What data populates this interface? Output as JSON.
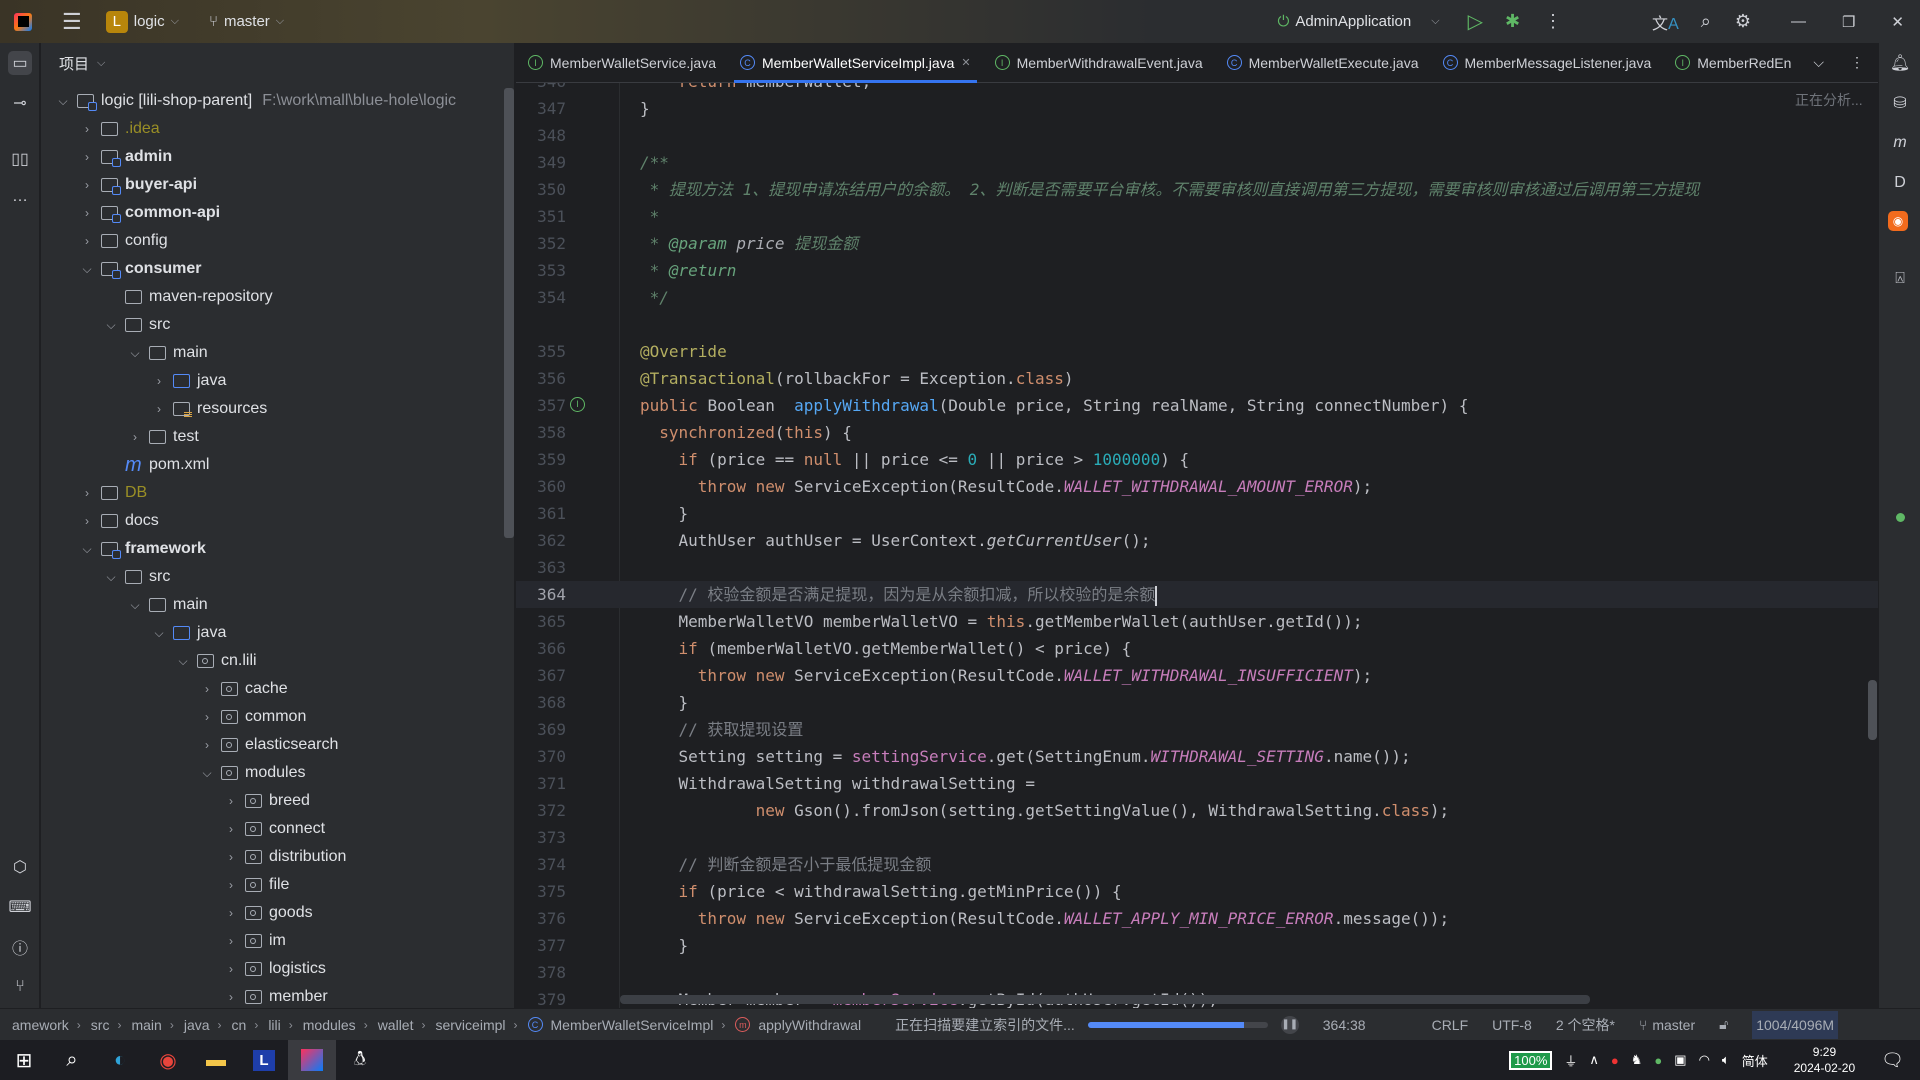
{
  "titlebar": {
    "project_initial": "L",
    "project": "logic",
    "branch": "master",
    "run_config": "AdminApplication"
  },
  "project_panel": {
    "title": "项目"
  },
  "tree": [
    {
      "d": 0,
      "name": "logic [lili-shop-parent]",
      "path": "F:\\work\\mall\\blue-hole\\logic",
      "icon": "mod",
      "exp": "open"
    },
    {
      "d": 1,
      "name": ".idea",
      "icon": "folder",
      "exp": "closed",
      "style": "excluded"
    },
    {
      "d": 1,
      "name": "admin",
      "icon": "mod",
      "exp": "closed",
      "style": "bold"
    },
    {
      "d": 1,
      "name": "buyer-api",
      "icon": "mod",
      "exp": "closed",
      "style": "bold"
    },
    {
      "d": 1,
      "name": "common-api",
      "icon": "mod",
      "exp": "closed",
      "style": "bold"
    },
    {
      "d": 1,
      "name": "config",
      "icon": "folder",
      "exp": "closed"
    },
    {
      "d": 1,
      "name": "consumer",
      "icon": "mod",
      "exp": "open",
      "style": "bold"
    },
    {
      "d": 2,
      "name": "maven-repository",
      "icon": "folder",
      "exp": "none"
    },
    {
      "d": 2,
      "name": "src",
      "icon": "folder",
      "exp": "open"
    },
    {
      "d": 3,
      "name": "main",
      "icon": "folder",
      "exp": "open"
    },
    {
      "d": 4,
      "name": "java",
      "icon": "src",
      "exp": "closed"
    },
    {
      "d": 4,
      "name": "resources",
      "icon": "res",
      "exp": "closed"
    },
    {
      "d": 3,
      "name": "test",
      "icon": "folder",
      "exp": "closed"
    },
    {
      "d": 2,
      "name": "pom.xml",
      "icon": "mvn",
      "exp": "none"
    },
    {
      "d": 1,
      "name": "DB",
      "icon": "folder",
      "exp": "closed",
      "style": "excluded"
    },
    {
      "d": 1,
      "name": "docs",
      "icon": "folder",
      "exp": "closed"
    },
    {
      "d": 1,
      "name": "framework",
      "icon": "mod",
      "exp": "open",
      "style": "bold"
    },
    {
      "d": 2,
      "name": "src",
      "icon": "folder",
      "exp": "open"
    },
    {
      "d": 3,
      "name": "main",
      "icon": "folder",
      "exp": "open"
    },
    {
      "d": 4,
      "name": "java",
      "icon": "src",
      "exp": "open"
    },
    {
      "d": 5,
      "name": "cn.lili",
      "icon": "pkg",
      "exp": "open"
    },
    {
      "d": 6,
      "name": "cache",
      "icon": "pkg",
      "exp": "closed"
    },
    {
      "d": 6,
      "name": "common",
      "icon": "pkg",
      "exp": "closed"
    },
    {
      "d": 6,
      "name": "elasticsearch",
      "icon": "pkg",
      "exp": "closed"
    },
    {
      "d": 6,
      "name": "modules",
      "icon": "pkg",
      "exp": "open"
    },
    {
      "d": 7,
      "name": "breed",
      "icon": "pkg",
      "exp": "closed"
    },
    {
      "d": 7,
      "name": "connect",
      "icon": "pkg",
      "exp": "closed"
    },
    {
      "d": 7,
      "name": "distribution",
      "icon": "pkg",
      "exp": "closed"
    },
    {
      "d": 7,
      "name": "file",
      "icon": "pkg",
      "exp": "closed"
    },
    {
      "d": 7,
      "name": "goods",
      "icon": "pkg",
      "exp": "closed"
    },
    {
      "d": 7,
      "name": "im",
      "icon": "pkg",
      "exp": "closed"
    },
    {
      "d": 7,
      "name": "logistics",
      "icon": "pkg",
      "exp": "closed"
    },
    {
      "d": 7,
      "name": "member",
      "icon": "pkg",
      "exp": "closed"
    }
  ],
  "tabs": [
    {
      "label": "MemberWalletService.java",
      "kind": "I"
    },
    {
      "label": "MemberWalletServiceImpl.java",
      "kind": "C",
      "active": true
    },
    {
      "label": "MemberWithdrawalEvent.java",
      "kind": "I"
    },
    {
      "label": "MemberWalletExecute.java",
      "kind": "C"
    },
    {
      "label": "MemberMessageListener.java",
      "kind": "C"
    },
    {
      "label": "MemberRedEn",
      "kind": "I"
    }
  ],
  "editor": {
    "analyzing": "正在分析...",
    "current_line": 364,
    "lines": [
      {
        "n": 346,
        "t": [
          [
            "",
            "    "
          ],
          [
            "kw",
            "return "
          ],
          [
            "",
            "memberWallet;"
          ]
        ]
      },
      {
        "n": 347,
        "t": [
          [
            "",
            "}"
          ]
        ]
      },
      {
        "n": 348,
        "t": []
      },
      {
        "n": 349,
        "t": [
          [
            "doc",
            "/**"
          ]
        ]
      },
      {
        "n": 350,
        "t": [
          [
            "doc",
            " * 提现方法 1、提现申请冻结用户的余额。 2、判断是否需要平台审核。不需要审核则直接调用第三方提现，需要审核则审核通过后调用第三方提现"
          ]
        ]
      },
      {
        "n": 351,
        "t": [
          [
            "doc",
            " *"
          ]
        ]
      },
      {
        "n": 352,
        "t": [
          [
            "doc",
            " * "
          ],
          [
            "doctag",
            "@param "
          ],
          [
            "docp",
            "price "
          ],
          [
            "doc",
            "提现金额"
          ]
        ]
      },
      {
        "n": 353,
        "t": [
          [
            "doc",
            " * "
          ],
          [
            "doctag",
            "@return"
          ]
        ]
      },
      {
        "n": 354,
        "t": [
          [
            "doc",
            " */"
          ]
        ]
      },
      {
        "n": 355,
        "gap": true,
        "t": [
          [
            "ann",
            "@Override"
          ]
        ]
      },
      {
        "n": 356,
        "t": [
          [
            "ann",
            "@Transactional"
          ],
          [
            "",
            "(rollbackFor = Exception."
          ],
          [
            "kw",
            "class"
          ],
          [
            "",
            ")"
          ]
        ]
      },
      {
        "n": 357,
        "impl": true,
        "t": [
          [
            "kw",
            "public "
          ],
          [
            "",
            "Boolean  "
          ],
          [
            "fn",
            "applyWithdrawal"
          ],
          [
            "",
            "(Double price, String realName, String connectNumber) {"
          ]
        ]
      },
      {
        "n": 358,
        "t": [
          [
            "",
            "  "
          ],
          [
            "kw",
            "synchronized"
          ],
          [
            "",
            "("
          ],
          [
            "kw",
            "this"
          ],
          [
            "",
            ") {"
          ]
        ]
      },
      {
        "n": 359,
        "t": [
          [
            "",
            "    "
          ],
          [
            "kw",
            "if "
          ],
          [
            "",
            "(price == "
          ],
          [
            "kw",
            "null"
          ],
          [
            "",
            " || price <= "
          ],
          [
            "num",
            "0"
          ],
          [
            "",
            " || price > "
          ],
          [
            "num",
            "1000000"
          ],
          [
            "",
            ") {"
          ]
        ]
      },
      {
        "n": 360,
        "t": [
          [
            "",
            "      "
          ],
          [
            "kw",
            "throw new "
          ],
          [
            "",
            "ServiceException(ResultCode."
          ],
          [
            "const",
            "WALLET_WITHDRAWAL_AMOUNT_ERROR"
          ],
          [
            "",
            ");"
          ]
        ]
      },
      {
        "n": 361,
        "t": [
          [
            "",
            "    }"
          ]
        ]
      },
      {
        "n": 362,
        "t": [
          [
            "",
            "    AuthUser authUser = UserContext."
          ],
          [
            "st",
            "getCurrentUser"
          ],
          [
            "",
            "();"
          ]
        ]
      },
      {
        "n": 363,
        "t": []
      },
      {
        "n": 364,
        "caret": true,
        "t": [
          [
            "",
            "    "
          ],
          [
            "cm",
            "// 校验金额是否满足提现，因为是从余额扣减，所以校验的是余额"
          ]
        ]
      },
      {
        "n": 365,
        "t": [
          [
            "",
            "    MemberWalletVO memberWalletVO = "
          ],
          [
            "kw",
            "this"
          ],
          [
            "",
            ".getMemberWallet(authUser.getId());"
          ]
        ]
      },
      {
        "n": 366,
        "t": [
          [
            "",
            "    "
          ],
          [
            "kw",
            "if "
          ],
          [
            "",
            "(memberWalletVO.getMemberWallet() < price) {"
          ]
        ]
      },
      {
        "n": 367,
        "t": [
          [
            "",
            "      "
          ],
          [
            "kw",
            "throw new "
          ],
          [
            "",
            "ServiceException(ResultCode."
          ],
          [
            "const",
            "WALLET_WITHDRAWAL_INSUFFICIENT"
          ],
          [
            "",
            ");"
          ]
        ]
      },
      {
        "n": 368,
        "t": [
          [
            "",
            "    }"
          ]
        ]
      },
      {
        "n": 369,
        "t": [
          [
            "",
            "    "
          ],
          [
            "cm",
            "// 获取提现设置"
          ]
        ]
      },
      {
        "n": 370,
        "t": [
          [
            "",
            "    Setting setting = "
          ],
          [
            "field",
            "settingService"
          ],
          [
            "",
            ".get(SettingEnum."
          ],
          [
            "const",
            "WITHDRAWAL_SETTING"
          ],
          [
            "",
            ".name());"
          ]
        ]
      },
      {
        "n": 371,
        "t": [
          [
            "",
            "    WithdrawalSetting withdrawalSetting ="
          ]
        ]
      },
      {
        "n": 372,
        "t": [
          [
            "",
            "            "
          ],
          [
            "kw",
            "new "
          ],
          [
            "",
            "Gson().fromJson(setting.getSettingValue(), WithdrawalSetting."
          ],
          [
            "kw",
            "class"
          ],
          [
            "",
            ");"
          ]
        ]
      },
      {
        "n": 373,
        "t": []
      },
      {
        "n": 374,
        "t": [
          [
            "",
            "    "
          ],
          [
            "cm",
            "// 判断金额是否小于最低提现金额"
          ]
        ]
      },
      {
        "n": 375,
        "t": [
          [
            "",
            "    "
          ],
          [
            "kw",
            "if "
          ],
          [
            "",
            "(price < withdrawalSetting.getMinPrice()) {"
          ]
        ]
      },
      {
        "n": 376,
        "t": [
          [
            "",
            "      "
          ],
          [
            "kw",
            "throw new "
          ],
          [
            "",
            "ServiceException(ResultCode."
          ],
          [
            "const",
            "WALLET_APPLY_MIN_PRICE_ERROR"
          ],
          [
            "",
            ".message());"
          ]
        ]
      },
      {
        "n": 377,
        "t": [
          [
            "",
            "    }"
          ]
        ]
      },
      {
        "n": 378,
        "t": []
      },
      {
        "n": 379,
        "t": [
          [
            "",
            "    Member member = "
          ],
          [
            "field",
            "memberService"
          ],
          [
            "",
            ".getById(authUser.getId());"
          ]
        ]
      }
    ]
  },
  "breadcrumb": [
    "amework",
    "src",
    "main",
    "java",
    "cn",
    "lili",
    "modules",
    "wallet",
    "serviceimpl",
    "MemberWalletServiceImpl",
    "applyWithdrawal"
  ],
  "status": {
    "indexing": "正在扫描要建立索引的文件...",
    "indexing_progress": 0.87,
    "position": "364:38",
    "line_sep": "CRLF",
    "encoding": "UTF-8",
    "indent": "2 个空格*",
    "branch": "master",
    "memory": "1004/4096M"
  },
  "taskbar": {
    "battery": "100%",
    "ime": "简体",
    "time": "9:29",
    "date": "2024-02-20"
  },
  "colors": {
    "accent": "#3574F0",
    "keyword": "#CF8E6D",
    "function": "#56A8F5",
    "constant": "#C77DBB",
    "annotation": "#B3AE60",
    "number": "#2AACB8"
  }
}
